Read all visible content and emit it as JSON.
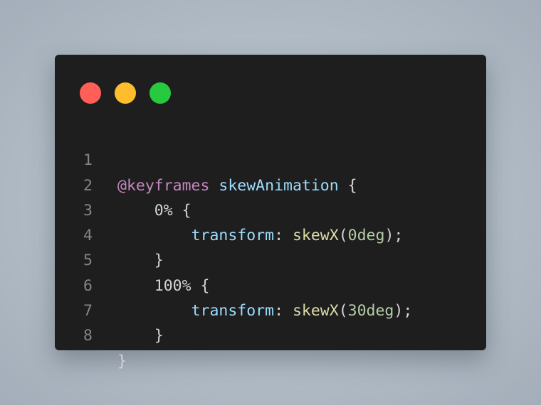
{
  "window": {
    "controls": {
      "close": {
        "icon": "close-dot-icon",
        "color": "#ff5f56"
      },
      "minimize": {
        "icon": "minimize-dot-icon",
        "color": "#ffbd2e"
      },
      "maximize": {
        "icon": "maximize-dot-icon",
        "color": "#27c93f"
      }
    }
  },
  "code": {
    "lines": [
      {
        "number": "1",
        "at_rule": "@keyframes",
        "name": "skewAnimation",
        "brace": "{"
      },
      {
        "number": "2",
        "indent": "    ",
        "selector": "0%",
        "brace": "{"
      },
      {
        "number": "3",
        "indent": "        ",
        "property": "transform",
        "colon": ":",
        "func": "skewX",
        "open": "(",
        "value": "0deg",
        "close": ");"
      },
      {
        "number": "4",
        "indent": "    ",
        "brace": "}"
      },
      {
        "number": "5",
        "indent": "    ",
        "selector": "100%",
        "brace": "{"
      },
      {
        "number": "6",
        "indent": "        ",
        "property": "transform",
        "colon": ":",
        "func": "skewX",
        "open": "(",
        "value": "30deg",
        "close": ");"
      },
      {
        "number": "7",
        "indent": "    ",
        "brace": "}"
      },
      {
        "number": "8",
        "brace": "}"
      }
    ]
  },
  "colors": {
    "background": "#1e1e1e",
    "keyword": "#c586c0",
    "identifier": "#9cdcfe",
    "function": "#dcdcaa",
    "number": "#b5cea8",
    "line_number": "#858585"
  }
}
